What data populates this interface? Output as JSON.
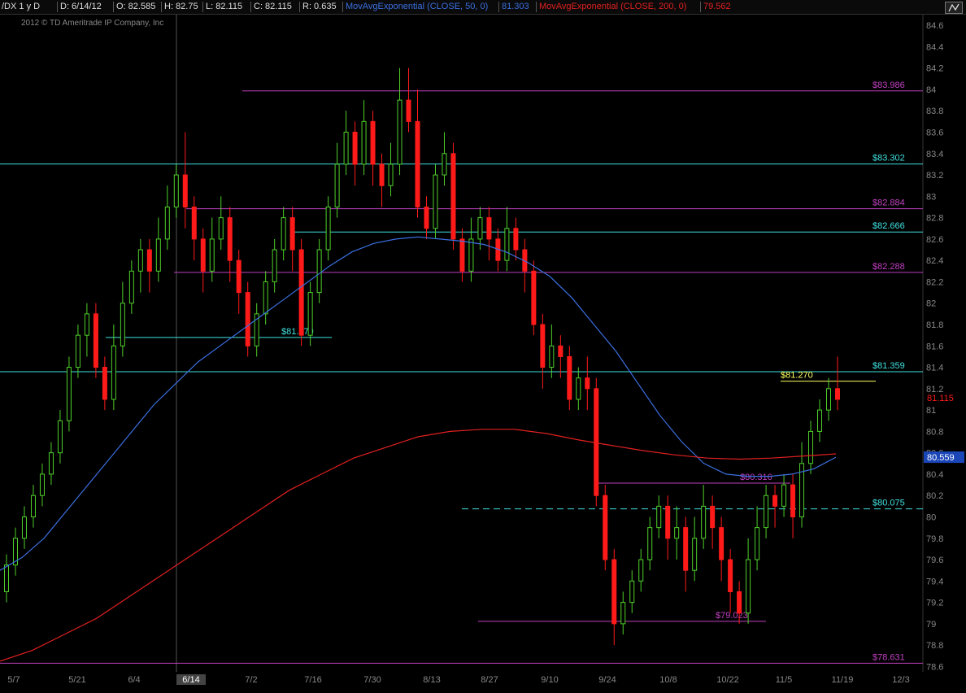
{
  "header": {
    "symbol": "/DX 1 y D",
    "date": "D: 6/14/12",
    "open": "O: 82.585",
    "high": "H: 82.75",
    "low": "L: 82.115",
    "close": "C: 82.115",
    "range": "R: 0.635",
    "ma50_label": "MovAvgExponential (CLOSE, 50, 0)",
    "ma50_value": "81.303",
    "ma200_label": "MovAvgExponential (CLOSE, 200, 0)",
    "ma200_value": "79.562"
  },
  "copyright": "2012 © TD Ameritrade IP Company, Inc",
  "colors": {
    "up": "#4fd02a",
    "down": "#ff1a1a",
    "ma50": "#3b6fe0",
    "ma200": "#e02020",
    "magenta": "#c040c0",
    "cyan": "#40e0e0",
    "yellow": "#ffff60",
    "axis_text": "#888888"
  },
  "chart_data": {
    "type": "candlestick",
    "x_ticks": [
      "5/7",
      "5/21",
      "6/4",
      "6/14",
      "7/2",
      "7/16",
      "7/30",
      "8/13",
      "8/27",
      "9/10",
      "9/24",
      "10/8",
      "10/22",
      "11/5",
      "11/19",
      "12/3"
    ],
    "cursor_date": "6/14",
    "y_ticks": [
      "84.6",
      "84.4",
      "84.2",
      "84",
      "83.8",
      "83.6",
      "83.4",
      "83.2",
      "83",
      "82.8",
      "82.6",
      "82.4",
      "82.2",
      "82",
      "81.8",
      "81.6",
      "81.4",
      "81.2",
      "81",
      "80.8",
      "80.6",
      "80.4",
      "80.2",
      "80",
      "79.8",
      "79.6",
      "79.4",
      "79.2",
      "79",
      "78.8",
      "78.6"
    ],
    "ylim": [
      78.55,
      84.7
    ],
    "last_price_label": "81.115",
    "ma50_price_label": "80.559",
    "levels": [
      {
        "label": "$83.986",
        "value": 83.986,
        "color": "magenta"
      },
      {
        "label": "$83.302",
        "value": 83.302,
        "color": "cyan"
      },
      {
        "label": "$82.884",
        "value": 82.884,
        "color": "magenta"
      },
      {
        "label": "$82.666",
        "value": 82.666,
        "color": "cyan"
      },
      {
        "label": "$82.288",
        "value": 82.288,
        "color": "magenta"
      },
      {
        "label": "$81.679",
        "value": 81.679,
        "color": "cyan"
      },
      {
        "label": "$81.359",
        "value": 81.359,
        "color": "cyan"
      },
      {
        "label": "$81.270",
        "value": 81.27,
        "color": "yellow"
      },
      {
        "label": "$80.316",
        "value": 80.316,
        "color": "magenta"
      },
      {
        "label": "$80.075",
        "value": 80.075,
        "color": "cyan"
      },
      {
        "label": "$79.023",
        "value": 79.023,
        "color": "magenta"
      },
      {
        "label": "$78.631",
        "value": 78.631,
        "color": "magenta"
      }
    ],
    "candles": [
      [
        79.3,
        79.55,
        79.2,
        79.65
      ],
      [
        79.55,
        79.8,
        79.45,
        79.9
      ],
      [
        79.8,
        80.0,
        79.7,
        80.1
      ],
      [
        80.0,
        80.2,
        79.9,
        80.3
      ],
      [
        80.2,
        80.4,
        80.1,
        80.5
      ],
      [
        80.4,
        80.6,
        80.3,
        80.7
      ],
      [
        80.6,
        80.9,
        80.5,
        81.0
      ],
      [
        80.9,
        81.4,
        80.8,
        81.5
      ],
      [
        81.4,
        81.7,
        81.3,
        81.8
      ],
      [
        81.7,
        81.9,
        81.5,
        82.0
      ],
      [
        81.9,
        81.4,
        81.3,
        82.0
      ],
      [
        81.4,
        81.1,
        81.0,
        81.5
      ],
      [
        81.1,
        81.6,
        81.0,
        81.8
      ],
      [
        81.6,
        82.0,
        81.5,
        82.2
      ],
      [
        82.0,
        82.3,
        81.9,
        82.4
      ],
      [
        82.3,
        82.5,
        82.1,
        82.6
      ],
      [
        82.5,
        82.3,
        82.1,
        82.6
      ],
      [
        82.3,
        82.6,
        82.2,
        82.8
      ],
      [
        82.6,
        82.9,
        82.5,
        83.1
      ],
      [
        82.9,
        83.2,
        82.8,
        83.3
      ],
      [
        83.2,
        82.9,
        82.7,
        83.6
      ],
      [
        82.9,
        82.6,
        82.4,
        83.0
      ],
      [
        82.6,
        82.3,
        82.1,
        82.7
      ],
      [
        82.3,
        82.6,
        82.2,
        82.8
      ],
      [
        82.6,
        82.8,
        82.5,
        83.0
      ],
      [
        82.8,
        82.4,
        82.2,
        82.9
      ],
      [
        82.4,
        82.1,
        81.9,
        82.5
      ],
      [
        82.1,
        81.6,
        81.5,
        82.2
      ],
      [
        81.6,
        81.9,
        81.5,
        82.0
      ],
      [
        81.9,
        82.2,
        81.8,
        82.3
      ],
      [
        82.2,
        82.5,
        82.1,
        82.6
      ],
      [
        82.5,
        82.8,
        82.4,
        82.9
      ],
      [
        82.8,
        82.5,
        82.3,
        82.9
      ],
      [
        82.5,
        81.7,
        81.6,
        82.6
      ],
      [
        81.7,
        82.1,
        81.6,
        82.2
      ],
      [
        82.1,
        82.5,
        82.0,
        82.6
      ],
      [
        82.5,
        82.9,
        82.4,
        83.0
      ],
      [
        82.9,
        83.3,
        82.8,
        83.5
      ],
      [
        83.3,
        83.6,
        83.2,
        83.8
      ],
      [
        83.6,
        83.3,
        83.1,
        83.7
      ],
      [
        83.3,
        83.7,
        83.2,
        83.9
      ],
      [
        83.7,
        83.3,
        83.1,
        83.8
      ],
      [
        83.3,
        83.1,
        82.9,
        83.4
      ],
      [
        83.1,
        83.3,
        83.0,
        83.5
      ],
      [
        83.3,
        83.9,
        83.2,
        84.2
      ],
      [
        83.9,
        83.7,
        83.6,
        84.2
      ],
      [
        83.7,
        82.9,
        82.8,
        84.0
      ],
      [
        82.9,
        82.7,
        82.6,
        83.0
      ],
      [
        82.7,
        83.2,
        82.6,
        83.3
      ],
      [
        83.2,
        83.4,
        83.1,
        83.6
      ],
      [
        83.4,
        82.6,
        82.5,
        83.5
      ],
      [
        82.6,
        82.3,
        82.2,
        82.7
      ],
      [
        82.3,
        82.6,
        82.2,
        82.8
      ],
      [
        82.6,
        82.8,
        82.5,
        82.9
      ],
      [
        82.8,
        82.6,
        82.4,
        82.9
      ],
      [
        82.6,
        82.4,
        82.3,
        82.7
      ],
      [
        82.4,
        82.7,
        82.3,
        82.9
      ],
      [
        82.7,
        82.5,
        82.4,
        82.8
      ],
      [
        82.5,
        82.3,
        82.1,
        82.6
      ],
      [
        82.3,
        81.8,
        81.7,
        82.4
      ],
      [
        81.8,
        81.4,
        81.2,
        81.9
      ],
      [
        81.4,
        81.6,
        81.3,
        81.8
      ],
      [
        81.6,
        81.5,
        81.3,
        81.7
      ],
      [
        81.5,
        81.1,
        81.0,
        81.6
      ],
      [
        81.1,
        81.3,
        81.0,
        81.4
      ],
      [
        81.3,
        81.2,
        81.0,
        81.5
      ],
      [
        81.2,
        80.2,
        80.1,
        81.3
      ],
      [
        80.2,
        79.6,
        79.5,
        80.3
      ],
      [
        79.6,
        79.0,
        78.8,
        79.7
      ],
      [
        79.0,
        79.2,
        78.9,
        79.3
      ],
      [
        79.2,
        79.4,
        79.1,
        79.5
      ],
      [
        79.4,
        79.6,
        79.3,
        79.7
      ],
      [
        79.6,
        79.9,
        79.5,
        80.0
      ],
      [
        79.9,
        80.1,
        79.8,
        80.2
      ],
      [
        80.1,
        79.8,
        79.6,
        80.2
      ],
      [
        79.8,
        79.9,
        79.6,
        80.1
      ],
      [
        79.9,
        79.5,
        79.3,
        80.0
      ],
      [
        79.5,
        79.8,
        79.4,
        80.0
      ],
      [
        79.8,
        80.1,
        79.7,
        80.3
      ],
      [
        80.1,
        79.9,
        79.7,
        80.2
      ],
      [
        79.9,
        79.6,
        79.4,
        80.0
      ],
      [
        79.6,
        79.3,
        79.1,
        79.7
      ],
      [
        79.3,
        79.1,
        79.0,
        79.4
      ],
      [
        79.1,
        79.6,
        79.0,
        79.8
      ],
      [
        79.6,
        79.9,
        79.5,
        80.1
      ],
      [
        79.9,
        80.2,
        79.8,
        80.3
      ],
      [
        80.2,
        80.1,
        79.9,
        80.3
      ],
      [
        80.1,
        80.3,
        80.0,
        80.4
      ],
      [
        80.3,
        80.0,
        79.8,
        80.4
      ],
      [
        80.0,
        80.5,
        79.9,
        80.7
      ],
      [
        80.5,
        80.8,
        80.4,
        80.9
      ],
      [
        80.8,
        81.0,
        80.7,
        81.1
      ],
      [
        81.0,
        81.2,
        80.9,
        81.3
      ],
      [
        81.2,
        81.1,
        81.0,
        81.5
      ]
    ],
    "ma50": [
      79.5,
      79.62,
      79.8,
      80.05,
      80.3,
      80.55,
      80.8,
      81.05,
      81.25,
      81.45,
      81.6,
      81.75,
      81.9,
      82.05,
      82.2,
      82.35,
      82.48,
      82.56,
      82.6,
      82.62,
      82.6,
      82.58,
      82.55,
      82.48,
      82.38,
      82.25,
      82.05,
      81.8,
      81.55,
      81.25,
      80.95,
      80.7,
      80.5,
      80.4,
      80.38,
      80.38,
      80.4,
      80.45,
      80.559
    ],
    "ma200": [
      78.65,
      78.75,
      78.9,
      79.05,
      79.25,
      79.45,
      79.65,
      79.85,
      80.05,
      80.25,
      80.4,
      80.55,
      80.65,
      80.75,
      80.8,
      80.82,
      80.82,
      80.78,
      80.72,
      80.67,
      80.62,
      80.58,
      80.55,
      80.54,
      80.55,
      80.57,
      80.59
    ]
  }
}
